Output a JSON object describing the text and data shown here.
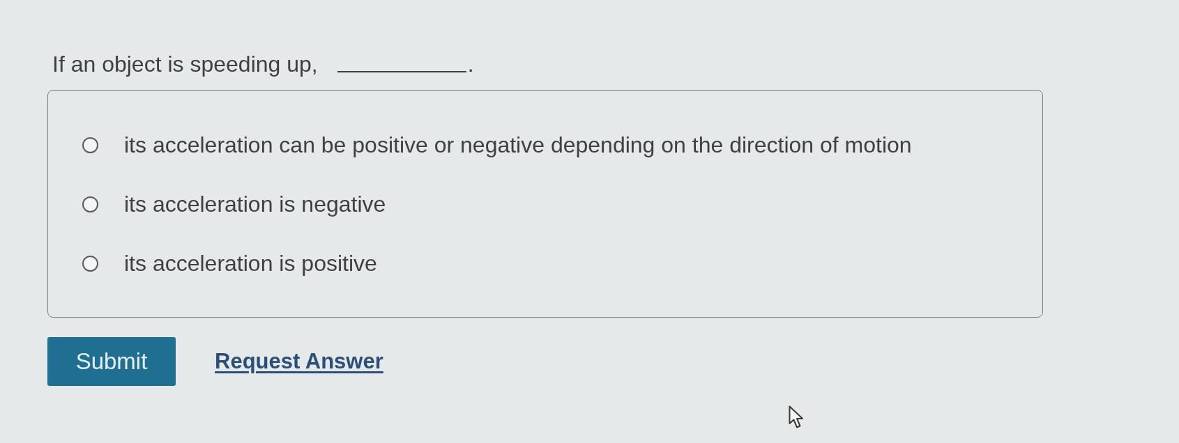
{
  "question": {
    "text": "If an object is speeding up,",
    "after_blank": "."
  },
  "options": [
    {
      "label": "its acceleration can be positive or negative depending on the direction of motion",
      "selected": false
    },
    {
      "label": "its acceleration is negative",
      "selected": false
    },
    {
      "label": "its acceleration is positive",
      "selected": false
    }
  ],
  "actions": {
    "submit": "Submit",
    "request_answer": "Request Answer"
  }
}
